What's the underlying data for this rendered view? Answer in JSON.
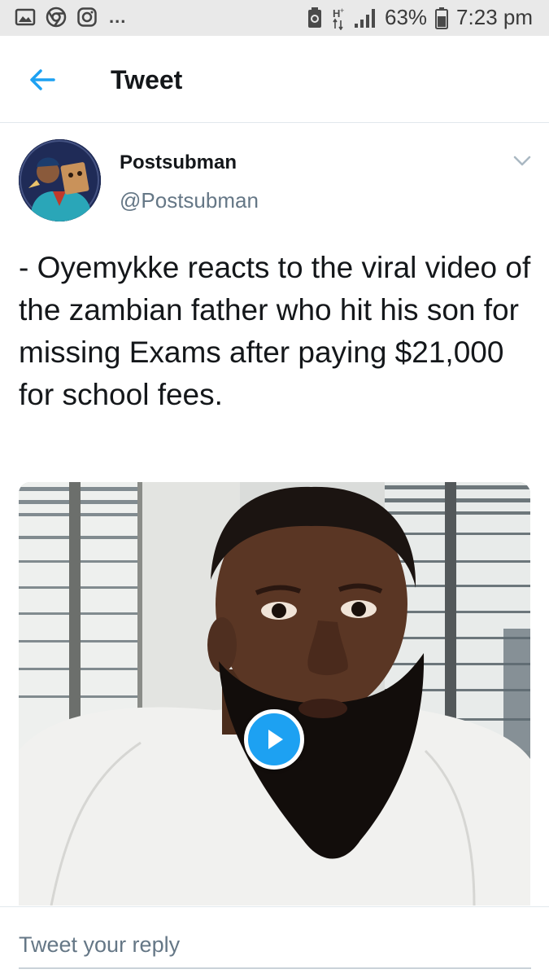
{
  "status_bar": {
    "battery": "63%",
    "time": "7:23 pm",
    "more": "...",
    "icons": [
      "gallery-icon",
      "chrome-icon",
      "instagram-icon",
      "recycle-icon",
      "h-plus-data-icon",
      "signal-icon",
      "battery-icon"
    ]
  },
  "header": {
    "back_icon": "arrow-left-icon",
    "title": "Tweet"
  },
  "tweet": {
    "author_name": "Postsubman",
    "author_handle": "@Postsubman",
    "text": "- Oyemykke reacts to the viral video of the zambian father who hit his son for missing Exams after paying $21,000 for school fees.",
    "media": {
      "type": "video",
      "play_icon": "play-icon"
    },
    "menu_icon": "chevron-down-icon"
  },
  "reply": {
    "placeholder": "Tweet your reply"
  },
  "colors": {
    "accent": "#1da1f2",
    "text": "#14171a",
    "secondary": "#657786",
    "status_bar_bg": "#e9e9e9"
  }
}
